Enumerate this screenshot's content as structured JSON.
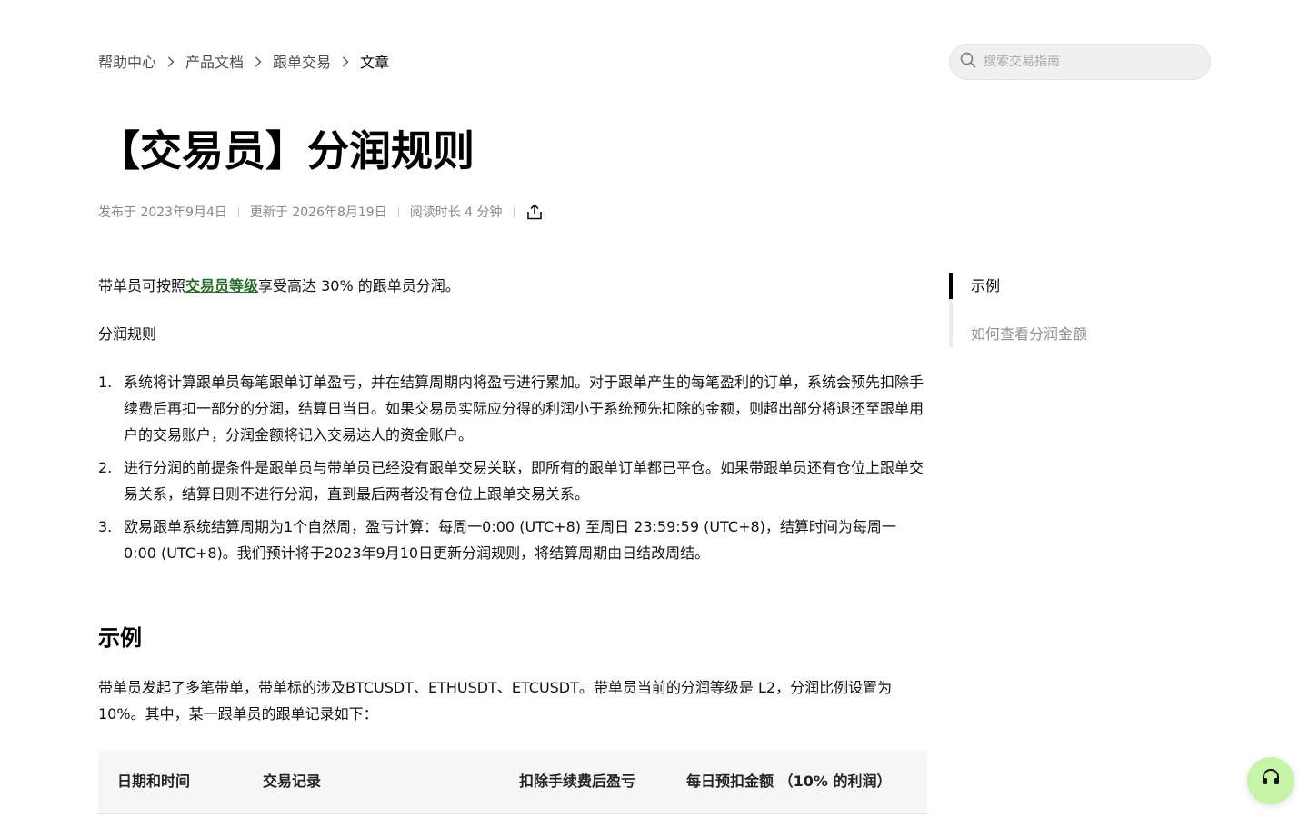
{
  "breadcrumb": {
    "items": [
      "帮助中心",
      "产品文档",
      "跟单交易"
    ],
    "current": "文章"
  },
  "search": {
    "placeholder": "搜索交易指南"
  },
  "article": {
    "title": "【交易员】分润规则",
    "published": "发布于 2023年9月4日",
    "updated": "更新于 2026年8月19日",
    "reading_time": "阅读时长 4 分钟",
    "intro_before": "带单员可按照",
    "intro_link": "交易员等级",
    "intro_after": "享受高达 30% 的跟单员分润。",
    "rules_heading": "分润规则",
    "rules": [
      {
        "num": "1.",
        "text": "系统将计算跟单员每笔跟单订单盈亏，并在结算周期内将盈亏进行累加。对于跟单产生的每笔盈利的订单，系统会预先扣除手续费后再扣一部分的分润，结算日当日。如果交易员实际应分得的利润小于系统预先扣除的金额，则超出部分将退还至跟单用户的交易账户，分润金额将记入交易达人的资金账户。"
      },
      {
        "num": "2.",
        "text": "进行分润的前提条件是跟单员与带单员已经没有跟单交易关联，即所有的跟单订单都已平仓。如果带跟单员还有仓位上跟单交易关系，结算日则不进行分润，直到最后两者没有仓位上跟单交易关系。"
      },
      {
        "num": "3.",
        "text": "欧易跟单系统结算周期为1个自然周，盈亏计算：每周一0:00 (UTC+8) 至周日 23:59:59 (UTC+8)，结算时间为每周一 0:00 (UTC+8)。我们预计将于2023年9月10日更新分润规则，将结算周期由日结改周结。"
      }
    ],
    "example_heading": "示例",
    "example_text": "带单员发起了多笔带单，带单标的涉及BTCUSDT、ETHUSDT、ETCUSDT。带单员当前的分润等级是 L2，分润比例设置为 10%。其中，某一跟单员的跟单记录如下：",
    "table_headers": [
      "日期和时间",
      "交易记录",
      "扣除手续费后盈亏",
      "每日预扣金额 （10% 的利润）"
    ]
  },
  "toc": {
    "items": [
      {
        "label": "示例",
        "active": true
      },
      {
        "label": "如何查看分润金额",
        "active": false
      }
    ]
  },
  "icons": {
    "search": "search-icon",
    "chevron": "chevron-right-icon",
    "share": "share-icon",
    "support": "headset-icon"
  },
  "colors": {
    "link": "#256d2a",
    "support_button": "#c6f4a6"
  }
}
